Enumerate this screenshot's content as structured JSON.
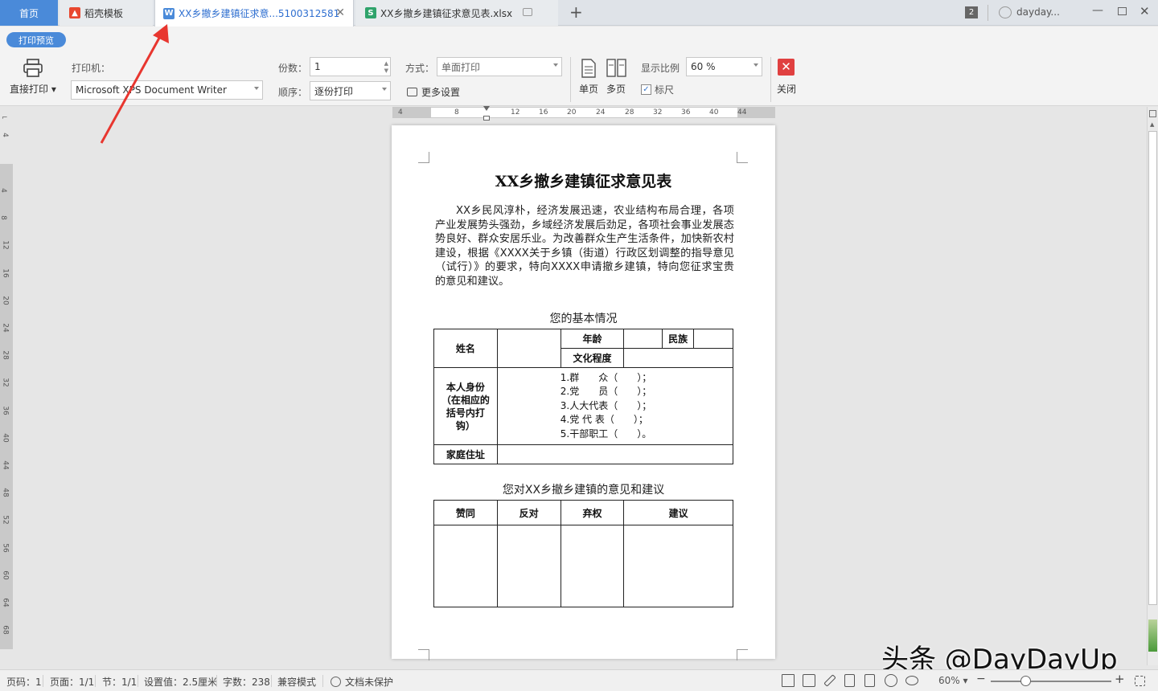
{
  "tabs": [
    {
      "label": "首页"
    },
    {
      "label": "稻壳模板"
    },
    {
      "label": "XX乡撤乡建镇征求意...5100312581"
    },
    {
      "label": "XX乡撤乡建镇征求意见表.xlsx"
    }
  ],
  "titlebar": {
    "window_count": "2",
    "user": "dayday..."
  },
  "toolbar": {
    "mode_label": "打印预览",
    "direct_print": "直接打印",
    "printer_label": "打印机：",
    "printer_value": "Microsoft XPS Document Writer",
    "copies_label": "份数：",
    "copies_value": "1",
    "order_label": "顺序：",
    "order_value": "逐份打印",
    "method_label": "方式：",
    "method_value": "单面打印",
    "more_settings": "更多设置",
    "single_page": "单页",
    "multi_page": "多页",
    "zoom_label": "显示比例",
    "zoom_value": "60 %",
    "ruler_label": "标尺",
    "close_label": "关闭"
  },
  "hruler_ticks": [
    "4",
    "4",
    "8",
    "12",
    "16",
    "20",
    "24",
    "28",
    "32",
    "36",
    "40",
    "44"
  ],
  "vruler_ticks": [
    "4",
    "8",
    "12",
    "16",
    "20",
    "24",
    "28",
    "32",
    "36",
    "40",
    "44",
    "48",
    "52",
    "56",
    "60",
    "64",
    "68"
  ],
  "document": {
    "title": "XX乡撤乡建镇征求意见表",
    "body": "XX乡民风淳朴，经济发展迅速，农业结构布局合理，各项产业发展势头强劲，乡域经济发展后劲足，各项社会事业发展态势良好、群众安居乐业。为改善群众生产生活条件，加快新农村建设，根据《XXXX关于乡镇（街道）行政区划调整的指导意见（试行）》的要求，特向XXXX申请撤乡建镇，特向您征求宝贵的意见和建议。",
    "section1": "您的基本情况",
    "t1": {
      "name": "姓名",
      "age": "年龄",
      "ethnic": "民族",
      "education": "文化程度",
      "identity": "本人身份（在相应的括号内打钩）",
      "options": [
        "1.群　　众（　　）；",
        "2.党　　员（　　）；",
        "3.人大代表（　　）；",
        "4.党 代 表（　　）；",
        "5.干部职工（　　）。"
      ],
      "address": "家庭住址"
    },
    "section2": "您对XX乡撤乡建镇的意见和建议",
    "t2": {
      "agree": "赞同",
      "oppose": "反对",
      "abstain": "弃权",
      "suggest": "建议"
    }
  },
  "status": {
    "page": "页码：1",
    "pages": "页面：1/1",
    "section": "节：1/1",
    "setting": "设置值：2.5厘米",
    "words": "字数：238",
    "compat": "兼容模式",
    "protect": "文档未保护",
    "zoom": "60%"
  },
  "watermark": "头条 @DayDayUp",
  "colors": {
    "accent": "#4a8ad9",
    "arrow": "#e8362f",
    "close": "#e04040"
  }
}
